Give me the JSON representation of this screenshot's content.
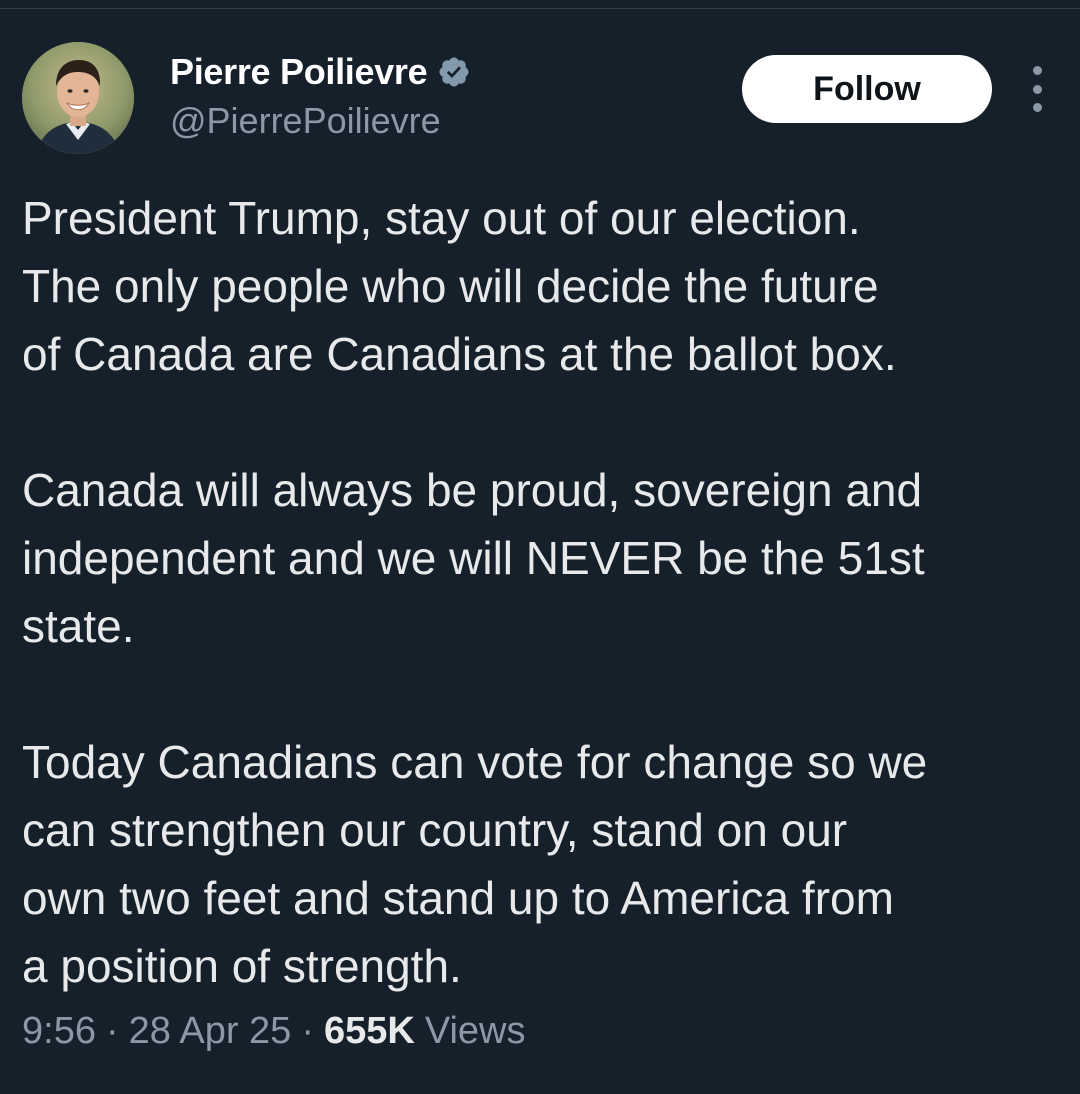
{
  "author": {
    "name": "Pierre Poilievre",
    "handle": "@PierrePoilievre",
    "verified_icon": "verified-badge-icon",
    "avatar_icon": "profile-photo"
  },
  "actions": {
    "follow_label": "Follow",
    "more_icon": "more-vertical-icon"
  },
  "tweet": {
    "paragraphs": [
      "President Trump, stay out of our election.\nThe only people who will decide the future\nof Canada are Canadians at the ballot box.",
      "Canada will always be proud, sovereign and\nindependent and we will NEVER be the 51st\nstate.",
      "Today Canadians can vote for change so we\ncan strengthen our country, stand on our\nown two feet and stand up to America from\na position of strength."
    ]
  },
  "meta": {
    "time": "9:56",
    "separator": "·",
    "date": "28 Apr 25",
    "views_count": "655K",
    "views_label": "Views"
  },
  "colors": {
    "background": "#15202b",
    "text": "#e7e9ea",
    "secondary_text": "#8b98a5",
    "follow_button_bg": "#ffffff",
    "follow_button_text": "#0f1419"
  }
}
